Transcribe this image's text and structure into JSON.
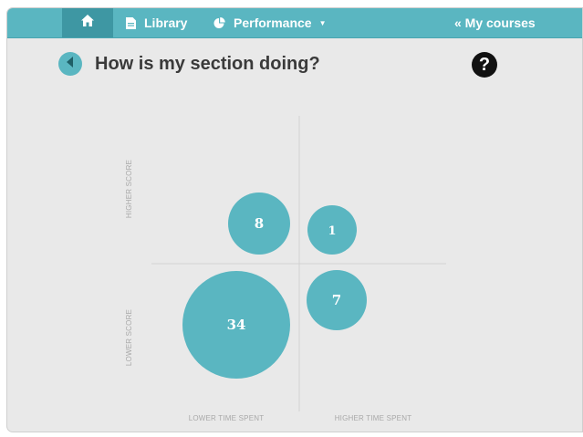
{
  "nav": {
    "home_icon": "home-icon",
    "library_label": "Library",
    "library_icon": "document-icon",
    "performance_label": "Performance",
    "performance_icon": "pie-chart-icon",
    "performance_caret": "▼",
    "mycourses_label": "« My courses"
  },
  "header": {
    "title": "How is my section doing?",
    "back_icon": "back-arrow-icon",
    "help_icon": "help-icon",
    "help_glyph": "?"
  },
  "colors": {
    "accent": "#5ab6c1",
    "accent_dark": "#3e97a3",
    "background": "#e9e9e9"
  },
  "chart_data": {
    "type": "scatter",
    "quadrant_labels": {
      "y_top": "HIGHER SCORE",
      "y_bottom": "LOWER SCORE",
      "x_left": "LOWER TIME SPENT",
      "x_right": "HIGHER TIME SPENT"
    },
    "bubbles": [
      {
        "quadrant": "lower-time-higher-score",
        "value": 8
      },
      {
        "quadrant": "higher-time-higher-score",
        "value": 1
      },
      {
        "quadrant": "lower-time-lower-score",
        "value": 34
      },
      {
        "quadrant": "higher-time-lower-score",
        "value": 7
      }
    ]
  }
}
